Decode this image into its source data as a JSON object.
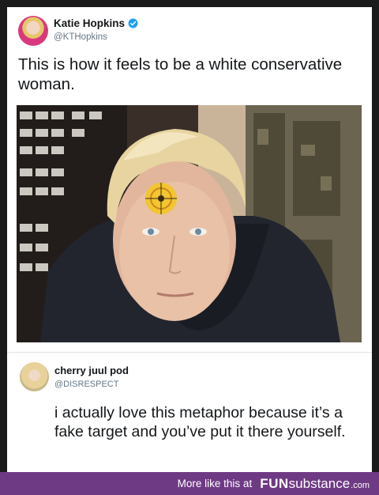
{
  "tweet": {
    "author": "Katie Hopkins",
    "handle": "@KTHopkins",
    "verified_icon": "verified-badge-icon",
    "text": "This is how it feels to be a white conservative woman."
  },
  "reply": {
    "author": "cherry juul pod",
    "handle": "@DISRESPECT",
    "text": "i actually love this metaphor because it’s a fake target and you’ve put it there yourself."
  },
  "footer": {
    "more_text": "More like this at",
    "brand_fun": "FUN",
    "brand_substance": "substance",
    "brand_tld": ".com"
  },
  "colors": {
    "footer_bg": "#6f3a84",
    "verified_blue": "#1da1f2"
  }
}
